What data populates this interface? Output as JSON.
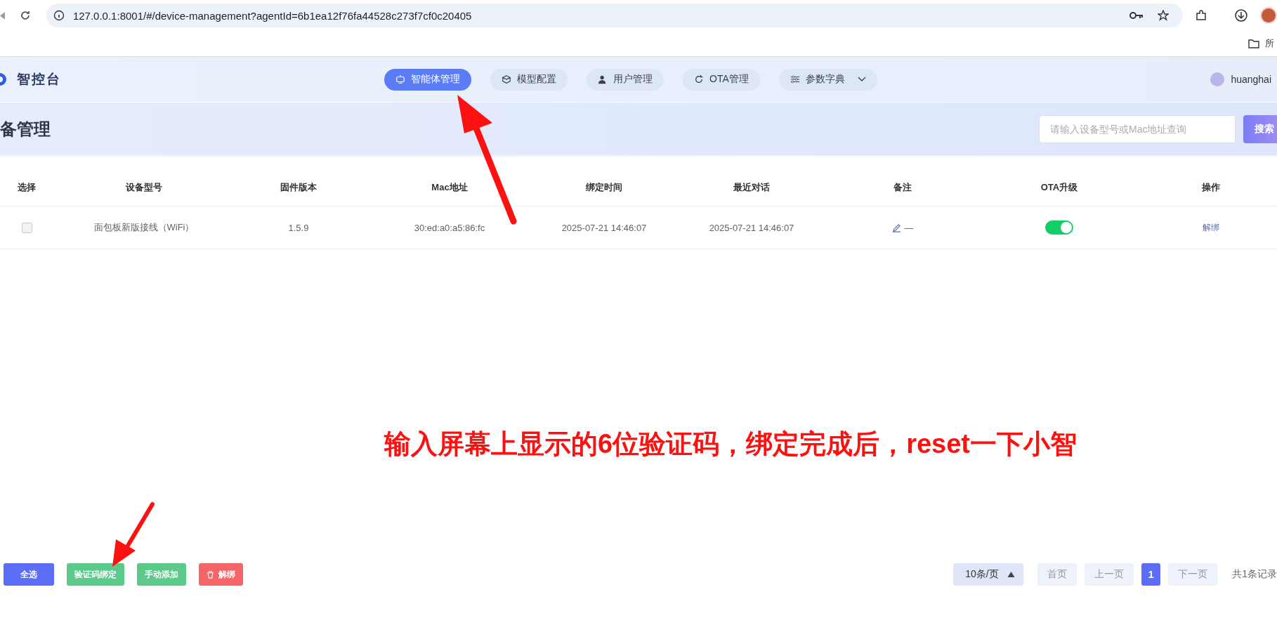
{
  "browser": {
    "url": "127.0.0.1:8001/#/device-management?agentId=6b1ea12f76fa44528c273f7cf0c20405",
    "bookmark": "所"
  },
  "header": {
    "brand": "智控台",
    "nav": [
      {
        "label": "智能体管理",
        "selected": true,
        "dropdown": false
      },
      {
        "label": "模型配置",
        "selected": false,
        "dropdown": false
      },
      {
        "label": "用户管理",
        "selected": false,
        "dropdown": false
      },
      {
        "label": "OTA管理",
        "selected": false,
        "dropdown": false
      },
      {
        "label": "参数字典",
        "selected": false,
        "dropdown": true
      }
    ],
    "user": "huanghai"
  },
  "page": {
    "title": "备管理",
    "search": {
      "placeholder": "请输入设备型号或Mac地址查询"
    },
    "search_button": "搜索"
  },
  "table": {
    "columns": [
      "选择",
      "设备型号",
      "固件版本",
      "Mac地址",
      "绑定时间",
      "最近对话",
      "备注",
      "OTA升级",
      "操作"
    ],
    "rows": [
      {
        "checked": false,
        "model": "面包板新版接线（WiFi）",
        "firmware": "1.5.9",
        "mac": "30:ed:a0:a5:86:fc",
        "bound": "2025-07-21 14:46:07",
        "last_chat": "2025-07-21 14:46:07",
        "remark": "—",
        "ota": true,
        "action": "解绑"
      }
    ]
  },
  "annotation": "输入屏幕上显示的6位验证码，绑定完成后，reset一下小智",
  "footer": {
    "buttons": [
      {
        "label": "全选",
        "kind": "primary"
      },
      {
        "label": "验证码绑定",
        "kind": "success"
      },
      {
        "label": "手动添加",
        "kind": "success"
      },
      {
        "label": "解绑",
        "kind": "danger"
      }
    ],
    "page_size": "10条/页",
    "first": "首页",
    "prev": "上一页",
    "pages": [
      {
        "label": "1",
        "selected": true
      }
    ],
    "next": "下一页",
    "total": "共1条记录"
  }
}
